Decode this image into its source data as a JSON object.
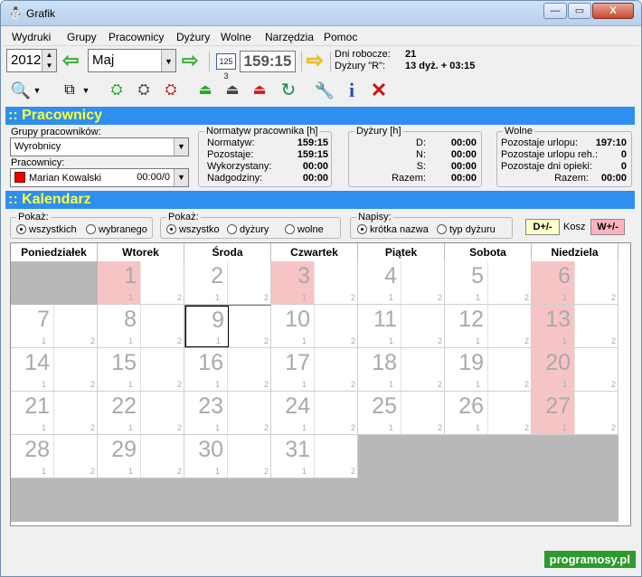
{
  "window": {
    "title": "Grafik",
    "min_glyph": "—",
    "max_glyph": "▭",
    "close_glyph": "X"
  },
  "menu": [
    "Wydruki",
    "Grupy",
    "Pracownicy",
    "Dyżury",
    "Wolne",
    "Narzędzia",
    "Pomoc"
  ],
  "toolbar1": {
    "year": "2012",
    "month": "Maj",
    "time": "159:15",
    "calendar_icon_text": "125 3",
    "dni_robocze_label": "Dni robocze:",
    "dni_robocze_value": "21",
    "dyzury_r_label": "Dyżury \"R\":",
    "dyzury_r_value": "13 dyż. + 03:15"
  },
  "toolbar2_icons": [
    "magnify-icon",
    "copy-icon",
    "add-duty-icon",
    "edit-duty-icon",
    "remove-duty-icon",
    "add-free-icon",
    "edit-free-icon",
    "remove-free-icon",
    "refresh-icon",
    "wrench-icon",
    "info-icon",
    "delete-icon"
  ],
  "pracownicy": {
    "section_title": ":: Pracownicy",
    "grupy_label": "Grupy pracowników:",
    "grupa_value": "Wyrobnicy",
    "pracownicy_label": "Pracownicy:",
    "pracownik_name": "Marian Kowalski",
    "pracownik_time": "00:00/0",
    "normatyw": {
      "title": "Normatyw pracownika [h]",
      "rows": [
        {
          "label": "Normatyw:",
          "value": "159:15"
        },
        {
          "label": "Pozostaje:",
          "value": "159:15"
        },
        {
          "label": "Wykorzystany:",
          "value": "00:00"
        },
        {
          "label": "Nadgodziny:",
          "value": "00:00"
        }
      ]
    },
    "dyzury": {
      "title": "Dyżury [h]",
      "rows": [
        {
          "label": "D:",
          "value": "00:00"
        },
        {
          "label": "N:",
          "value": "00:00"
        },
        {
          "label": "S:",
          "value": "00:00"
        },
        {
          "label": "Razem:",
          "value": "00:00"
        }
      ]
    },
    "wolne": {
      "title": "Wolne",
      "rows": [
        {
          "label": "Pozostaje urlopu:",
          "value": "197:10"
        },
        {
          "label": "Pozostaje urlopu reh.:",
          "value": "0"
        },
        {
          "label": "Pozostaje dni opieki:",
          "value": "0"
        },
        {
          "label": "Razem:",
          "value": "00:00"
        }
      ]
    }
  },
  "kalendarz": {
    "section_title": ":: Kalendarz",
    "pokaz1": {
      "title": "Pokaż:",
      "options": [
        "wszystkich",
        "wybranego"
      ]
    },
    "pokaz2": {
      "title": "Pokaż:",
      "options": [
        "wszystko",
        "dyżury",
        "wolne"
      ]
    },
    "napisy": {
      "title": "Napisy:",
      "options": [
        "krótka nazwa",
        "typ dyżuru"
      ]
    },
    "btn_d": "D+/-",
    "kosz": "Kosz",
    "btn_w": "W+/-",
    "days": [
      "Poniedziałek",
      "Wtorek",
      "Środa",
      "Czwartek",
      "Piątek",
      "Sobota",
      "Niedziela"
    ],
    "sub1": "1",
    "sub2": "2",
    "weeks": [
      [
        null,
        1,
        2,
        3,
        4,
        5,
        6
      ],
      [
        7,
        8,
        9,
        10,
        11,
        12,
        13
      ],
      [
        14,
        15,
        16,
        17,
        18,
        19,
        20
      ],
      [
        21,
        22,
        23,
        24,
        25,
        26,
        27
      ],
      [
        28,
        29,
        30,
        31,
        null,
        null,
        null
      ],
      [
        null,
        null,
        null,
        null,
        null,
        null,
        null
      ]
    ],
    "holidays": [
      1,
      3,
      6,
      13,
      20,
      27
    ],
    "selected": 9
  },
  "watermark": "programosy.pl",
  "colors": {
    "section_bar": "#2e8ff0",
    "section_text": "#ffff33",
    "holiday": "#f7c4c6"
  }
}
